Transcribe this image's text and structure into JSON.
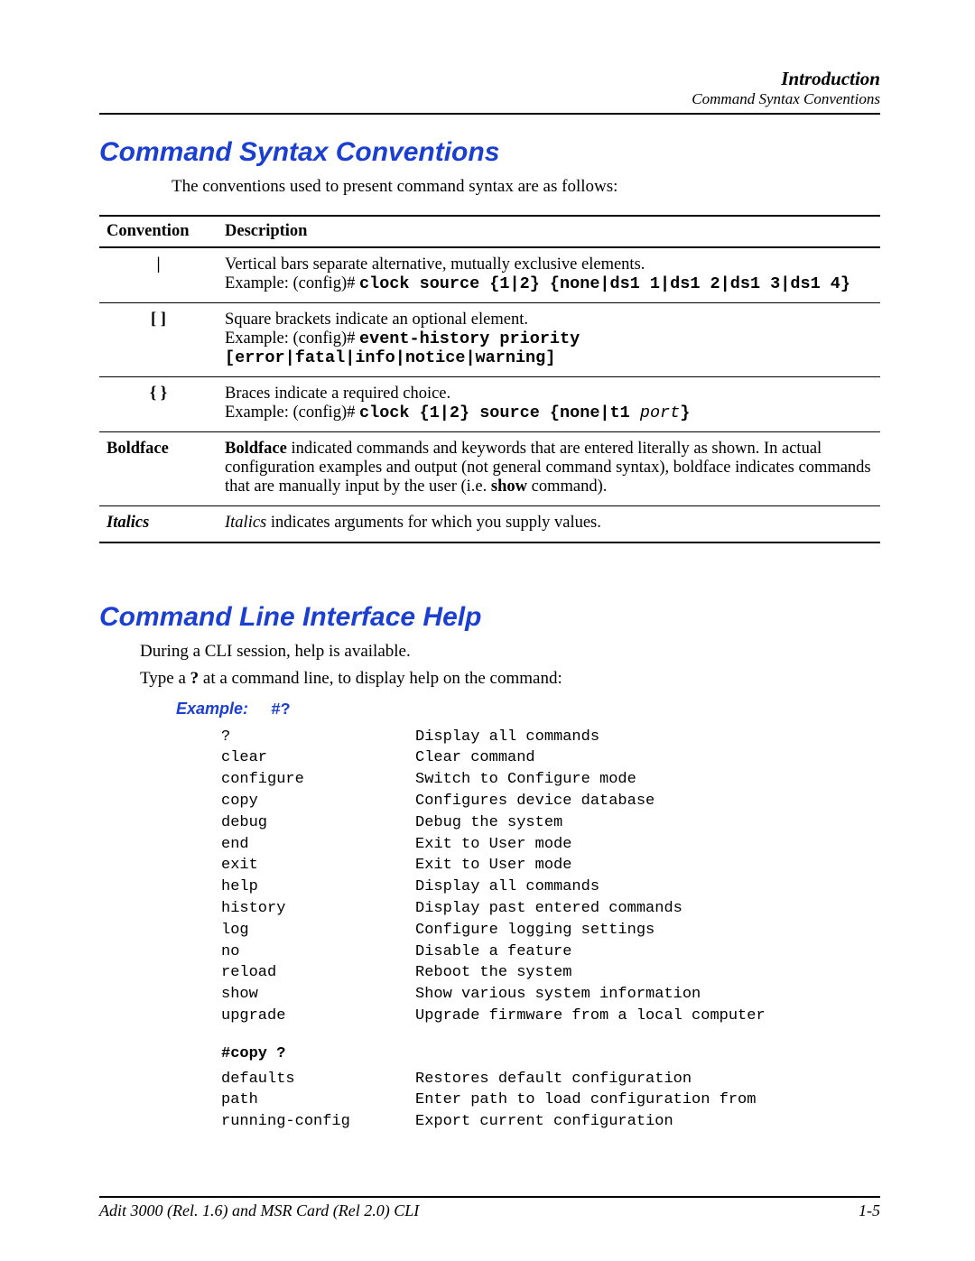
{
  "header": {
    "title": "Introduction",
    "subtitle": "Command Syntax Conventions"
  },
  "section1": {
    "heading": "Command Syntax Conventions",
    "intro": "The conventions used to present command syntax are as follows:"
  },
  "table": {
    "col1_header": "Convention",
    "col2_header": "Description",
    "rows": [
      {
        "conv": "|",
        "desc_line1": "Vertical bars separate alternative, mutually exclusive elements.",
        "ex_prefix": "Example: (config)# ",
        "ex_cmd": "clock source {1|2} {none|ds1 1|ds1 2|ds1 3|ds1 4}"
      },
      {
        "conv": "[ ]",
        "desc_line1": "Square brackets indicate an optional element.",
        "ex_prefix": "Example: (config)# ",
        "ex_cmd": "event-history priority [error|fatal|info|notice|warning]"
      },
      {
        "conv": "{ }",
        "desc_line1": "Braces indicate a required choice.",
        "ex_prefix": "Example: (config)# ",
        "ex_cmd_part1": "clock {1|2} source {none|t1 ",
        "ex_cmd_ital": "port",
        "ex_cmd_part2": "}"
      },
      {
        "conv": "Boldface",
        "desc_b1": "Boldface",
        "desc_r1": " indicated commands and keywords that are entered literally as shown. In actual configuration examples and output (not general command syntax), boldface indicates commands that are manually input by the user (i.e. ",
        "desc_b2": "show",
        "desc_r2": " command)."
      },
      {
        "conv": "Italics",
        "desc_i1": "Italics",
        "desc_r1": " indicates arguments for which you supply values."
      }
    ]
  },
  "section2": {
    "heading": "Command Line Interface Help",
    "p1": "During a CLI session, help is available.",
    "p2_a": "Type a  ",
    "p2_b": "?",
    "p2_c": " at a command line, to display help on the command:",
    "example_label": "Example:",
    "example_cmd": "#?",
    "commands": [
      {
        "name": "?",
        "desc": "Display all commands"
      },
      {
        "name": "clear",
        "desc": "Clear command"
      },
      {
        "name": "configure",
        "desc": "Switch to Configure mode"
      },
      {
        "name": "copy",
        "desc": "Configures device database"
      },
      {
        "name": "debug",
        "desc": "Debug the system"
      },
      {
        "name": "end",
        "desc": "Exit to User mode"
      },
      {
        "name": "exit",
        "desc": "Exit to User mode"
      },
      {
        "name": "help",
        "desc": "Display all commands"
      },
      {
        "name": "history",
        "desc": "Display past entered commands"
      },
      {
        "name": "log",
        "desc": "Configure logging settings"
      },
      {
        "name": "no",
        "desc": "Disable a feature"
      },
      {
        "name": "reload",
        "desc": "Reboot the system"
      },
      {
        "name": "show",
        "desc": "Show various system information"
      },
      {
        "name": "upgrade",
        "desc": "Upgrade firmware from a local computer"
      }
    ],
    "sub_prompt": "#copy ?",
    "sub_commands": [
      {
        "name": "defaults",
        "desc": "Restores default configuration"
      },
      {
        "name": "path",
        "desc": "Enter path to load configuration from"
      },
      {
        "name": "running-config",
        "desc": "Export current configuration"
      }
    ]
  },
  "footer": {
    "left": "Adit 3000 (Rel. 1.6) and MSR Card (Rel 2.0) CLI",
    "right": "1-5"
  }
}
